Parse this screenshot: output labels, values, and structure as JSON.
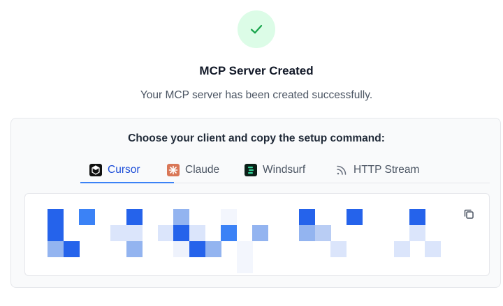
{
  "header": {
    "title": "MCP Server Created",
    "subtitle": "Your MCP server has been created successfully.",
    "success_icon": "check-icon",
    "success_color": "#16a34a"
  },
  "panel": {
    "heading": "Choose your client and copy the setup command:",
    "tabs": [
      {
        "label": "Cursor",
        "icon": "cursor-logo-icon",
        "active": true
      },
      {
        "label": "Claude",
        "icon": "claude-logo-icon",
        "active": false
      },
      {
        "label": "Windsurf",
        "icon": "windsurf-logo-icon",
        "active": false
      },
      {
        "label": "HTTP Stream",
        "icon": "rss-icon",
        "active": false
      }
    ],
    "code_box": {
      "content": "redacted setup command (pixelated)",
      "copy_icon": "copy-icon"
    }
  },
  "colors": {
    "accent": "#3b82f6",
    "success_bg": "#dcfce7",
    "redaction": [
      "#2563eb",
      "#3b82f6",
      "#93b4f0",
      "#dbe5fb"
    ]
  }
}
